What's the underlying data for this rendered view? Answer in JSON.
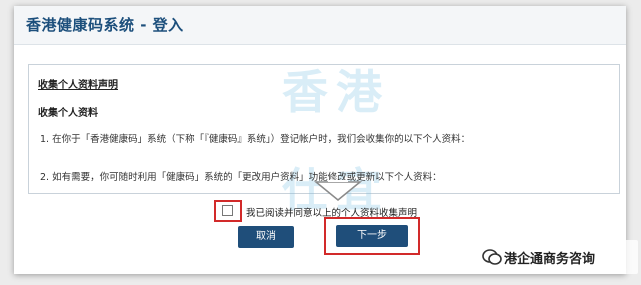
{
  "window": {
    "title": "香港健康码系统 - 登入"
  },
  "watermark": {
    "line1": "香港",
    "line2": "仕宜"
  },
  "notice": {
    "heading": "收集个人资料声明",
    "subheading": "收集个人资料",
    "item1": "1.  在你于「香港健康码」系统（下称「『健康码』系统」）登记帐户时，我们会收集你的以下个人资料：",
    "item2": "2.  如有需要，你可随时利用「健康码」系统的「更改用户资料」功能修改或更新以下个人资料："
  },
  "agreement": {
    "label": "我已阅读并同意以上的个人资料收集声明",
    "checked": false
  },
  "buttons": {
    "cancel": "取消",
    "next": "下一步"
  },
  "overlay": {
    "wechat_account": "港企通商务咨询",
    "icon": "wechat-icon"
  },
  "colors": {
    "button_bg": "#1f4e7a",
    "highlight": "#d22a2a",
    "title": "#1c4f7c"
  }
}
